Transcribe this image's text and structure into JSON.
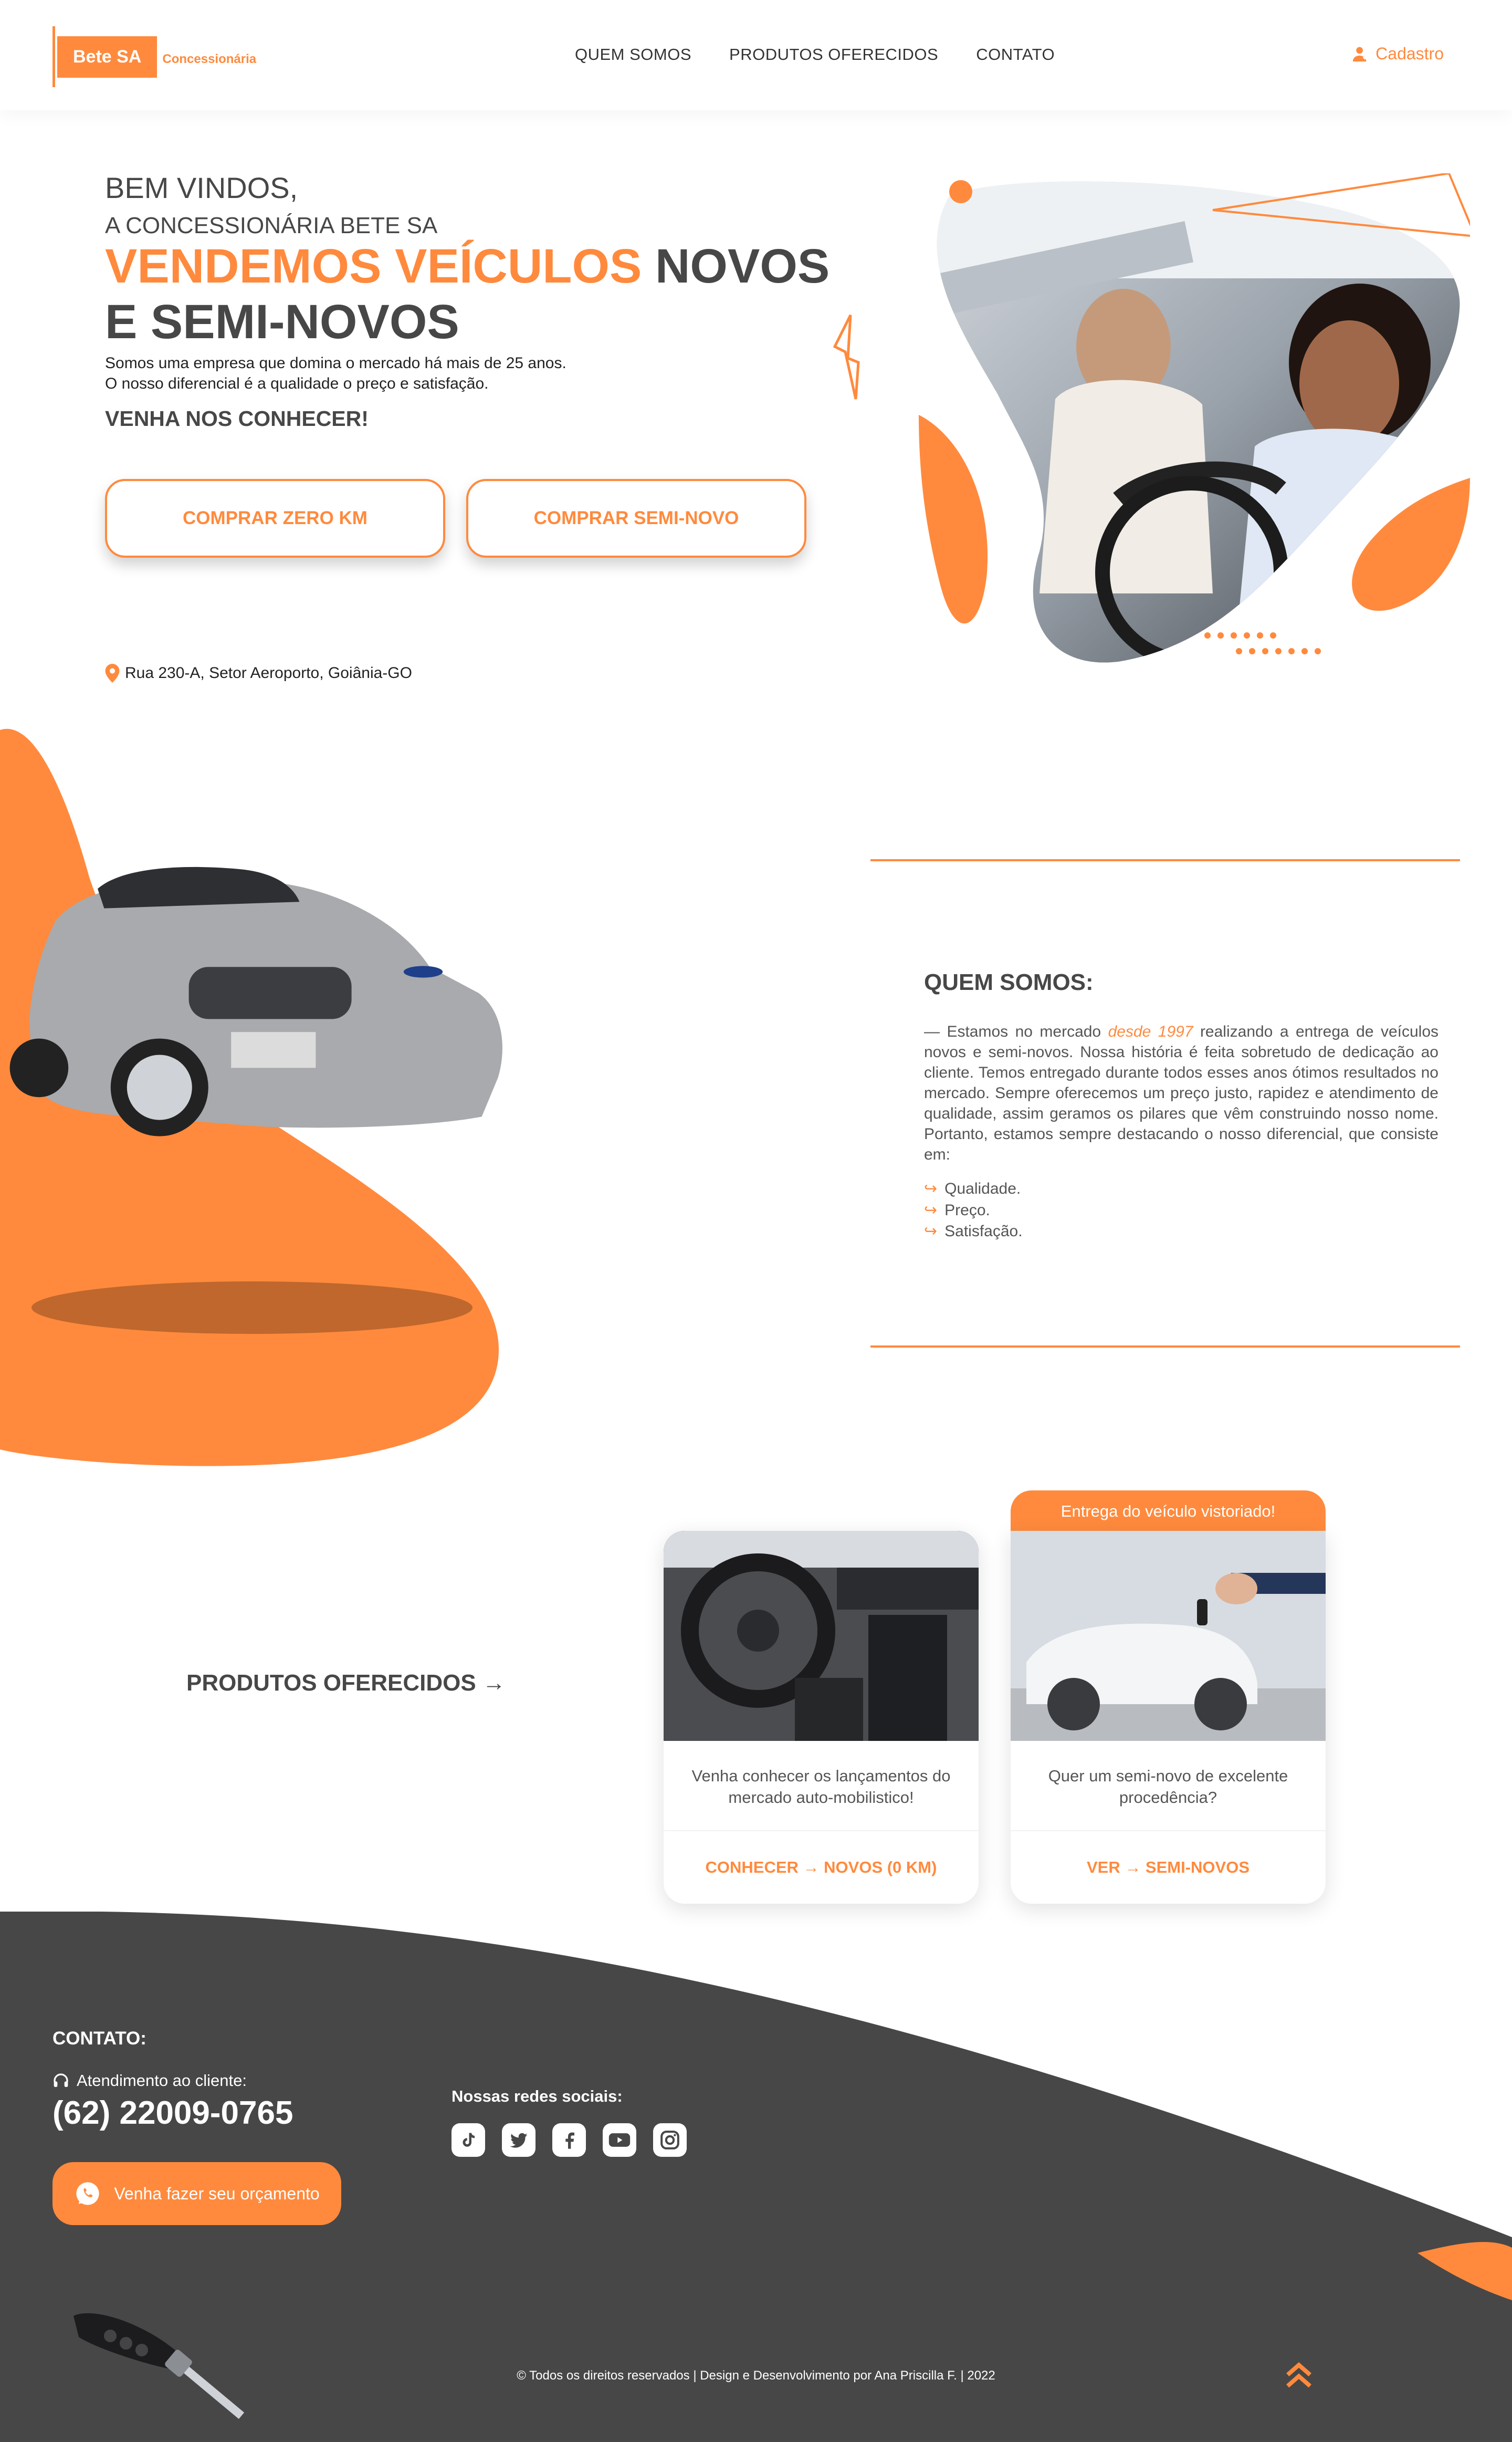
{
  "brand": {
    "name": "Bete SA",
    "tagline": "Concessionária",
    "accent": "#ff8a3d",
    "dark": "#474747"
  },
  "nav": {
    "items": [
      "QUEM SOMOS",
      "PRODUTOS OFERECIDOS",
      "CONTATO"
    ],
    "cadastro": "Cadastro"
  },
  "hero": {
    "welcome": "BEM VINDOS,",
    "welcome2": "A CONCESSIONÁRIA BETE SA",
    "headline_accent": "VENDEMOS VEÍCULOS",
    "headline_rest1": " NOVOS",
    "headline_rest2": "E SEMI-NOVOS",
    "para1": "Somos uma empresa que domina o mercado há mais de 25 anos.",
    "para2": "O nosso diferencial é a qualidade o preço e satisfação.",
    "cta": "VENHA NOS CONHECER!",
    "btn_zero": "COMPRAR ZERO KM",
    "btn_semi": "COMPRAR SEMI-NOVO",
    "address": "Rua 230-A, Setor Aeroporto, Goiânia-GO"
  },
  "about": {
    "title": "QUEM SOMOS:",
    "text_before": "— Estamos no mercado ",
    "text_highlight": "desde 1997",
    "text_after": " realizando a entrega de veículos novos e semi-novos. Nossa história é feita sobretudo de dedicação ao cliente. Temos entregado durante todos esses anos ótimos resultados no mercado. Sempre oferecemos um preço justo, rapidez e atendimento de qualidade, assim geramos os pilares que vêm construindo nosso nome. Portanto, estamos sempre destacando o nosso diferencial, que consiste em:",
    "list": [
      "Qualidade.",
      "Preço.",
      "Satisfação."
    ]
  },
  "products": {
    "title": "PRODUTOS OFERECIDOS →",
    "badge": "Entrega do veículo vistoriado!",
    "cards": [
      {
        "desc": "Venha conhecer os lançamentos do mercado auto-mobilistico!",
        "action": "CONHECER → NOVOS (0 KM)"
      },
      {
        "desc": "Quer um semi-novo de excelente procedência?",
        "action": "VER → SEMI-NOVOS"
      }
    ]
  },
  "footer": {
    "title": "CONTATO:",
    "attendance": "Atendimento ao cliente:",
    "phone": "(62) 22009-0765",
    "quote_btn": "Venha fazer seu orçamento",
    "social_title": "Nossas redes sociais:",
    "social": [
      "tiktok-icon",
      "twitter-icon",
      "facebook-icon",
      "youtube-icon",
      "instagram-icon"
    ],
    "copyright": "© Todos os direitos reservados | Design e Desenvolvimento por  Ana Priscilla F.  | 2022"
  }
}
